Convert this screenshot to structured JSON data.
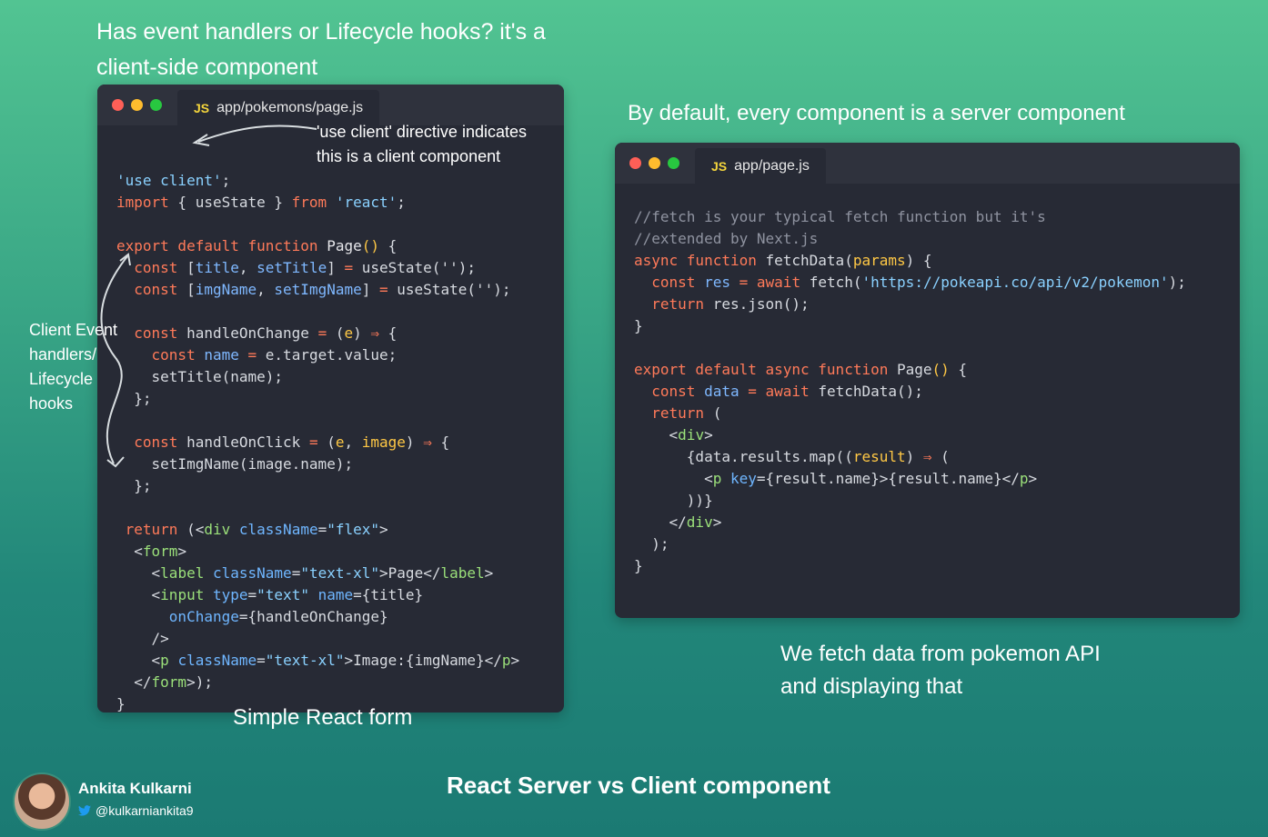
{
  "captions": {
    "client_heading": "Has event handlers or Lifecycle hooks? it's a client-side component",
    "server_heading": "By default, every component is a server component",
    "simple_form": "Simple React form",
    "fetch_note": "We fetch data from pokemon API and displaying that",
    "left_note": "Client Event handlers/ Lifecycle hooks",
    "directive_note": "'use client' directive indicates this is a client component",
    "main_title": "React Server vs Client component"
  },
  "client_window": {
    "badge": "JS",
    "filename": "app/pokemons/page.js"
  },
  "server_window": {
    "badge": "JS",
    "filename": "app/page.js"
  },
  "author": {
    "name": "Ankita Kulkarni",
    "handle": "@kulkarniankita9"
  },
  "colors": {
    "window_bg": "#272a35",
    "keyword": "#ff7a59",
    "string": "#8ad1ff",
    "param": "#ffc845",
    "tag": "#9be07a",
    "comment": "#8f93a0"
  }
}
